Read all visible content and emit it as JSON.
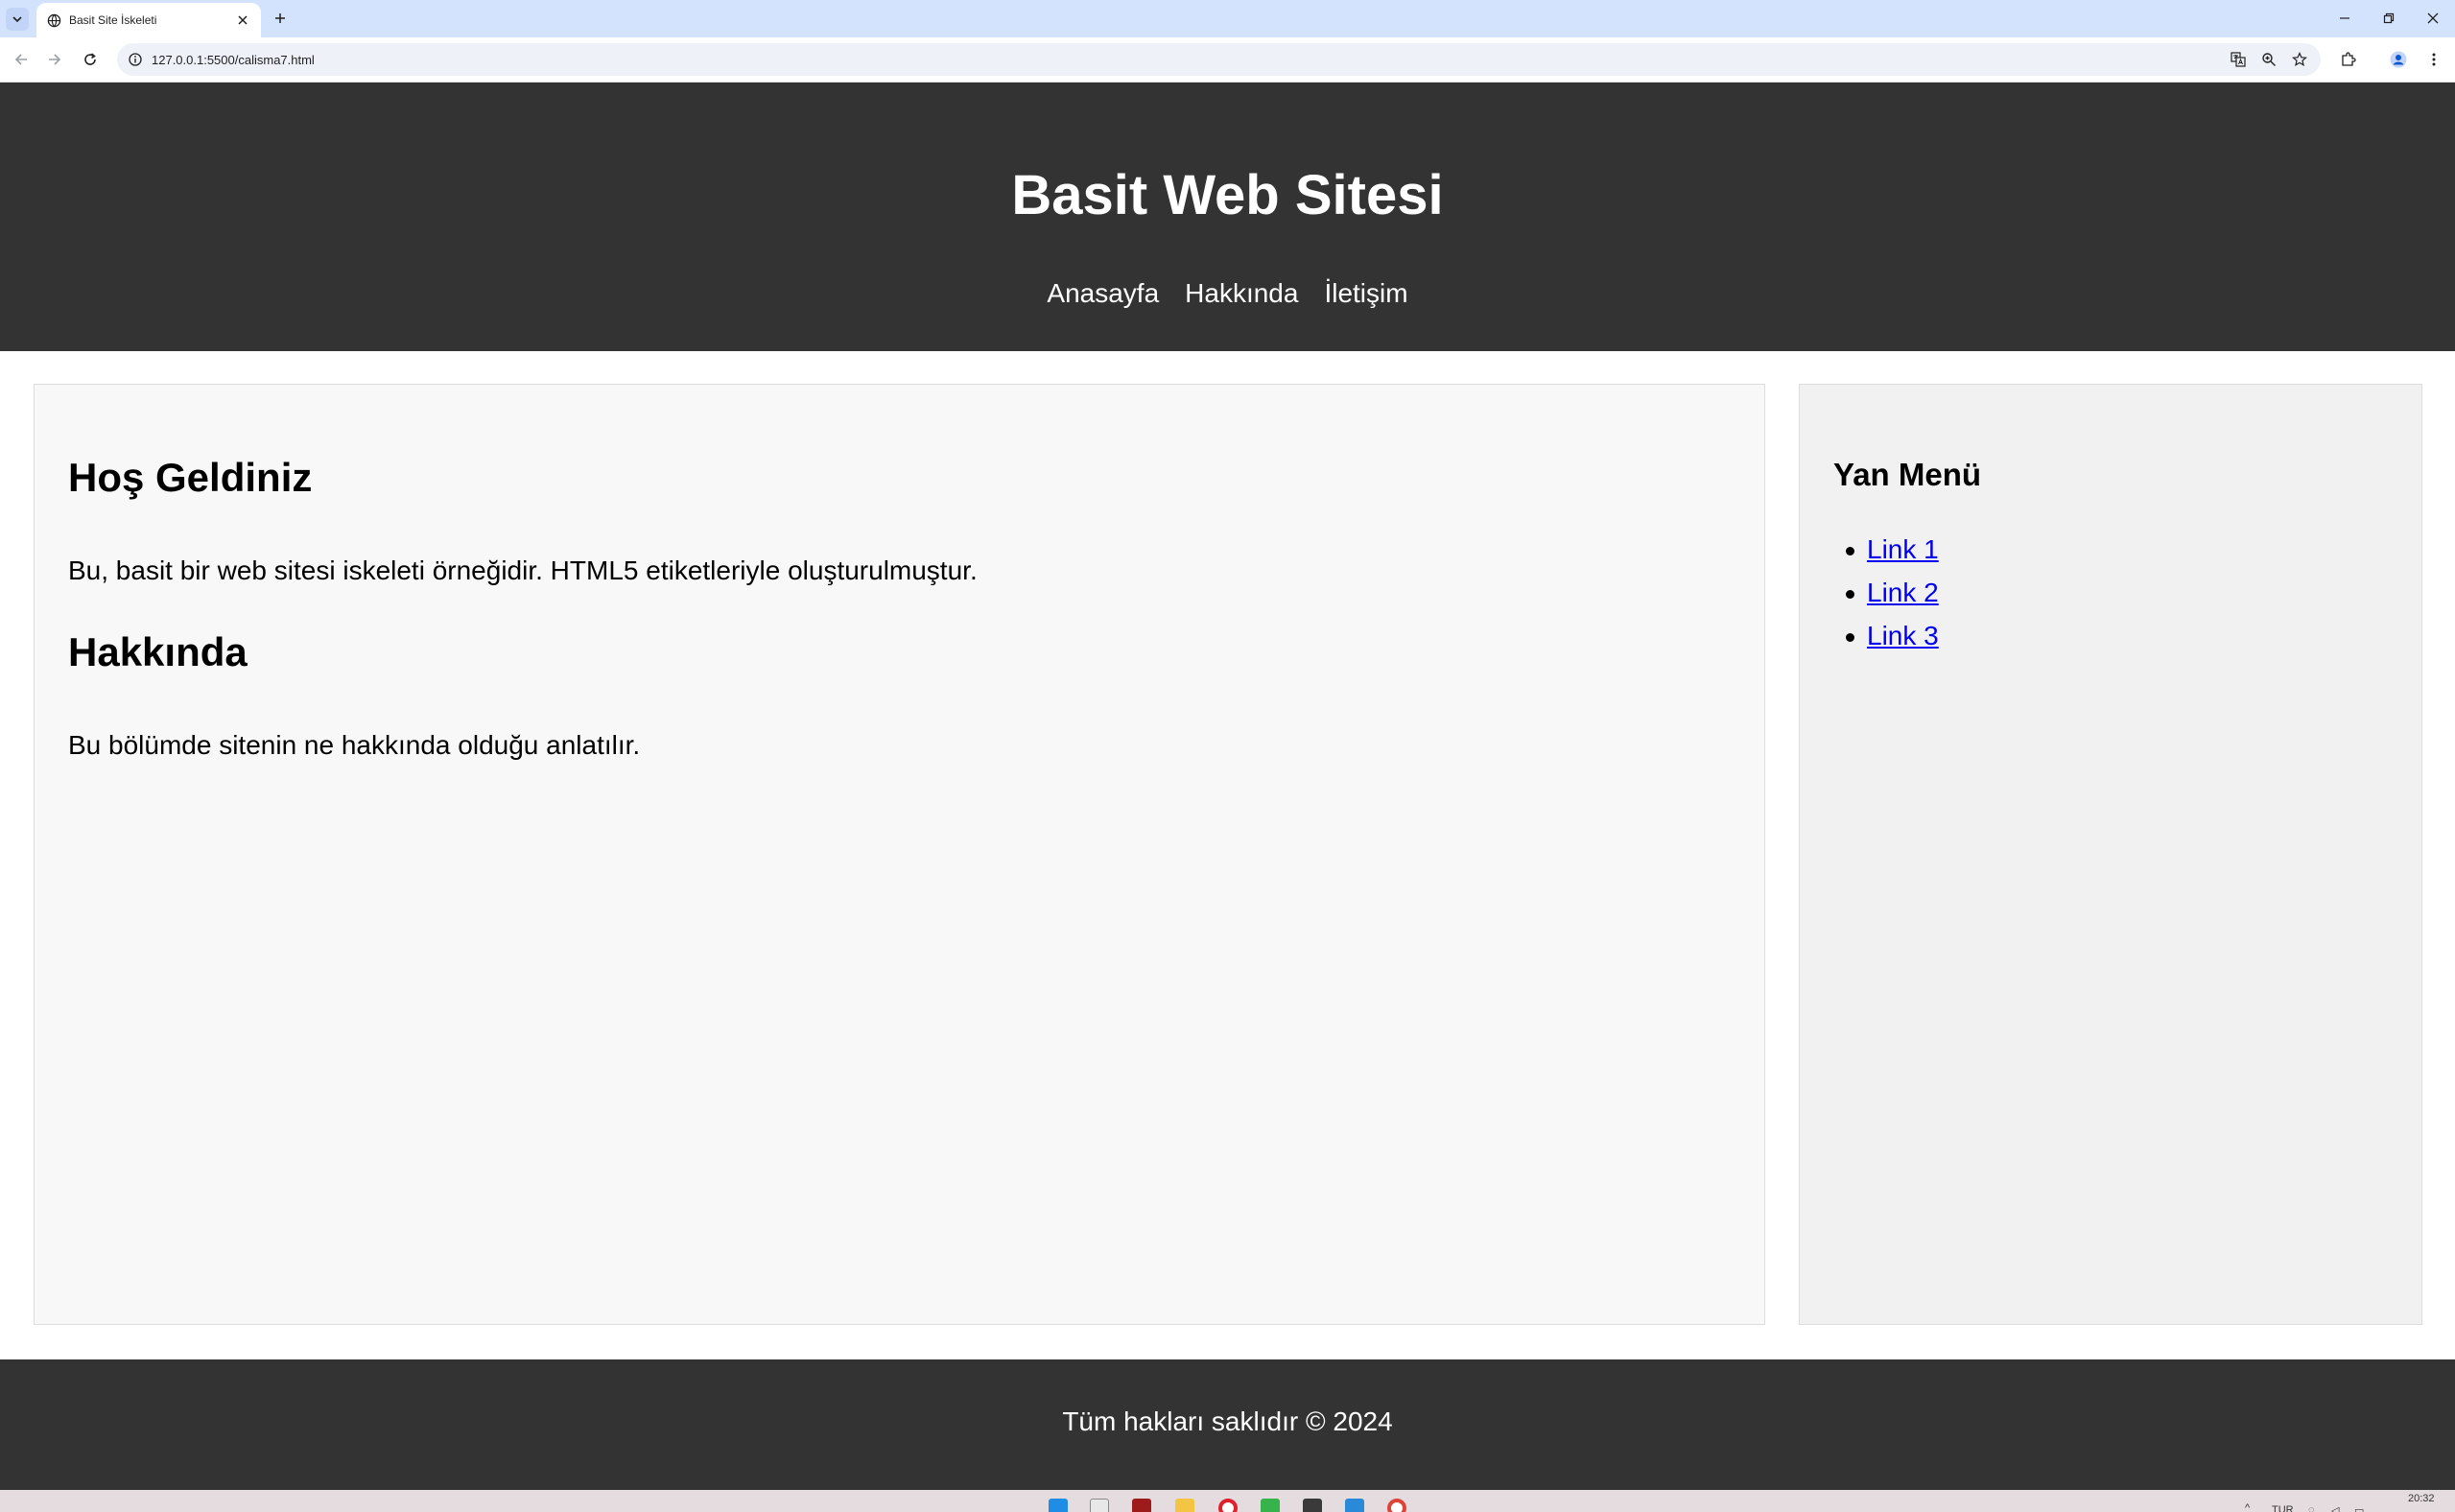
{
  "browser": {
    "tab_title": "Basit Site İskeleti",
    "url": "127.0.0.1:5500/calisma7.html"
  },
  "header": {
    "title": "Basit Web Sitesi",
    "nav": [
      "Anasayfa",
      "Hakkında",
      "İletişim"
    ]
  },
  "main": {
    "welcome_title": "Hoş Geldiniz",
    "welcome_text": "Bu, basit bir web sitesi iskeleti örneğidir. HTML5 etiketleriyle oluşturulmuştur.",
    "about_title": "Hakkında",
    "about_text": "Bu bölümde sitenin ne hakkında olduğu anlatılır."
  },
  "sidebar": {
    "title": "Yan Menü",
    "links": [
      "Link 1",
      "Link 2",
      "Link 3"
    ]
  },
  "footer": {
    "text": "Tüm hakları saklıdır © 2024"
  },
  "taskbar": {
    "language": "TUR",
    "time": "20:32"
  },
  "colors": {
    "header_bg": "#333333",
    "tab_strip": "#d3e3fd",
    "link": "#0000ee",
    "main_bg": "#f8f8f8",
    "sidebar_bg": "#f1f1f1"
  }
}
